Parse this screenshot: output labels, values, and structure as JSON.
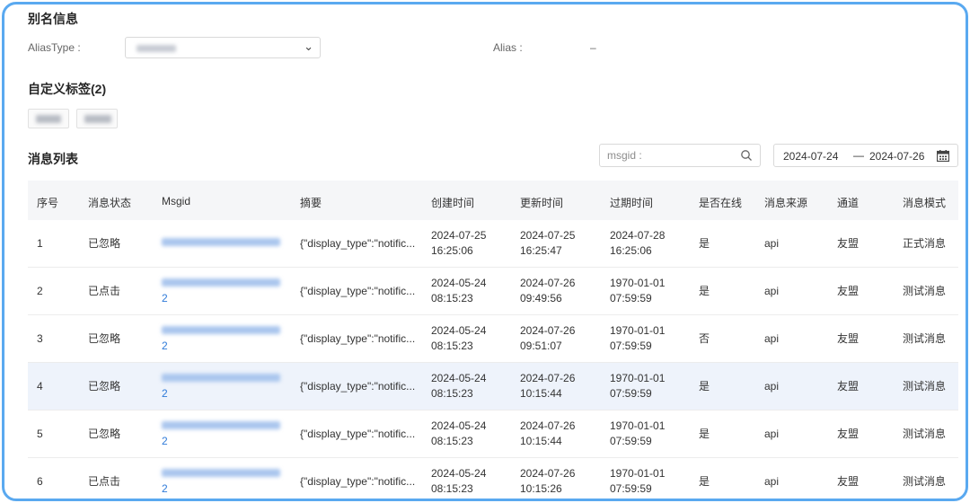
{
  "alias_section": {
    "title": "别名信息",
    "alias_type_label": "AliasType :",
    "alias_label": "Alias :",
    "alias_value": "–"
  },
  "tags_section": {
    "title": "自定义标签(2)"
  },
  "messages_section": {
    "title": "消息列表",
    "search_placeholder": "msgid :",
    "date_start": "2024-07-24",
    "date_separator": "—",
    "date_end": "2024-07-26"
  },
  "table": {
    "headers": [
      "序号",
      "消息状态",
      "Msgid",
      "摘要",
      "创建时间",
      "更新时间",
      "过期时间",
      "是否在线",
      "消息来源",
      "通道",
      "消息模式"
    ],
    "rows": [
      {
        "index": "1",
        "status": "已忽略",
        "msgid_tail": "",
        "summary": "{\"display_type\":\"notific...",
        "created": [
          "2024-07-25",
          "16:25:06"
        ],
        "updated": [
          "2024-07-25",
          "16:25:47"
        ],
        "expires": [
          "2024-07-28",
          "16:25:06"
        ],
        "online": "是",
        "source": "api",
        "channel": "友盟",
        "mode": "正式消息"
      },
      {
        "index": "2",
        "status": "已点击",
        "msgid_tail": "2",
        "summary": "{\"display_type\":\"notific...",
        "created": [
          "2024-05-24",
          "08:15:23"
        ],
        "updated": [
          "2024-07-26",
          "09:49:56"
        ],
        "expires": [
          "1970-01-01",
          "07:59:59"
        ],
        "online": "是",
        "source": "api",
        "channel": "友盟",
        "mode": "测试消息"
      },
      {
        "index": "3",
        "status": "已忽略",
        "msgid_tail": "2",
        "summary": "{\"display_type\":\"notific...",
        "created": [
          "2024-05-24",
          "08:15:23"
        ],
        "updated": [
          "2024-07-26",
          "09:51:07"
        ],
        "expires": [
          "1970-01-01",
          "07:59:59"
        ],
        "online": "否",
        "source": "api",
        "channel": "友盟",
        "mode": "测试消息"
      },
      {
        "index": "4",
        "status": "已忽略",
        "msgid_tail": "2",
        "summary": "{\"display_type\":\"notific...",
        "created": [
          "2024-05-24",
          "08:15:23"
        ],
        "updated": [
          "2024-07-26",
          "10:15:44"
        ],
        "expires": [
          "1970-01-01",
          "07:59:59"
        ],
        "online": "是",
        "source": "api",
        "channel": "友盟",
        "mode": "测试消息"
      },
      {
        "index": "5",
        "status": "已忽略",
        "msgid_tail": "2",
        "summary": "{\"display_type\":\"notific...",
        "created": [
          "2024-05-24",
          "08:15:23"
        ],
        "updated": [
          "2024-07-26",
          "10:15:44"
        ],
        "expires": [
          "1970-01-01",
          "07:59:59"
        ],
        "online": "是",
        "source": "api",
        "channel": "友盟",
        "mode": "测试消息"
      },
      {
        "index": "6",
        "status": "已点击",
        "msgid_tail": "2",
        "summary": "{\"display_type\":\"notific...",
        "created": [
          "2024-05-24",
          "08:15:23"
        ],
        "updated": [
          "2024-07-26",
          "10:15:26"
        ],
        "expires": [
          "1970-01-01",
          "07:59:59"
        ],
        "online": "是",
        "source": "api",
        "channel": "友盟",
        "mode": "测试消息"
      }
    ]
  },
  "colors": {
    "frame_border": "#5aa9f0",
    "link": "#2f7bd9",
    "header_bg": "#f5f6f8",
    "highlight_row": "#eef3fb"
  },
  "icons": {
    "select": "chevron-down-icon",
    "search": "search-icon",
    "date": "calendar-icon"
  }
}
